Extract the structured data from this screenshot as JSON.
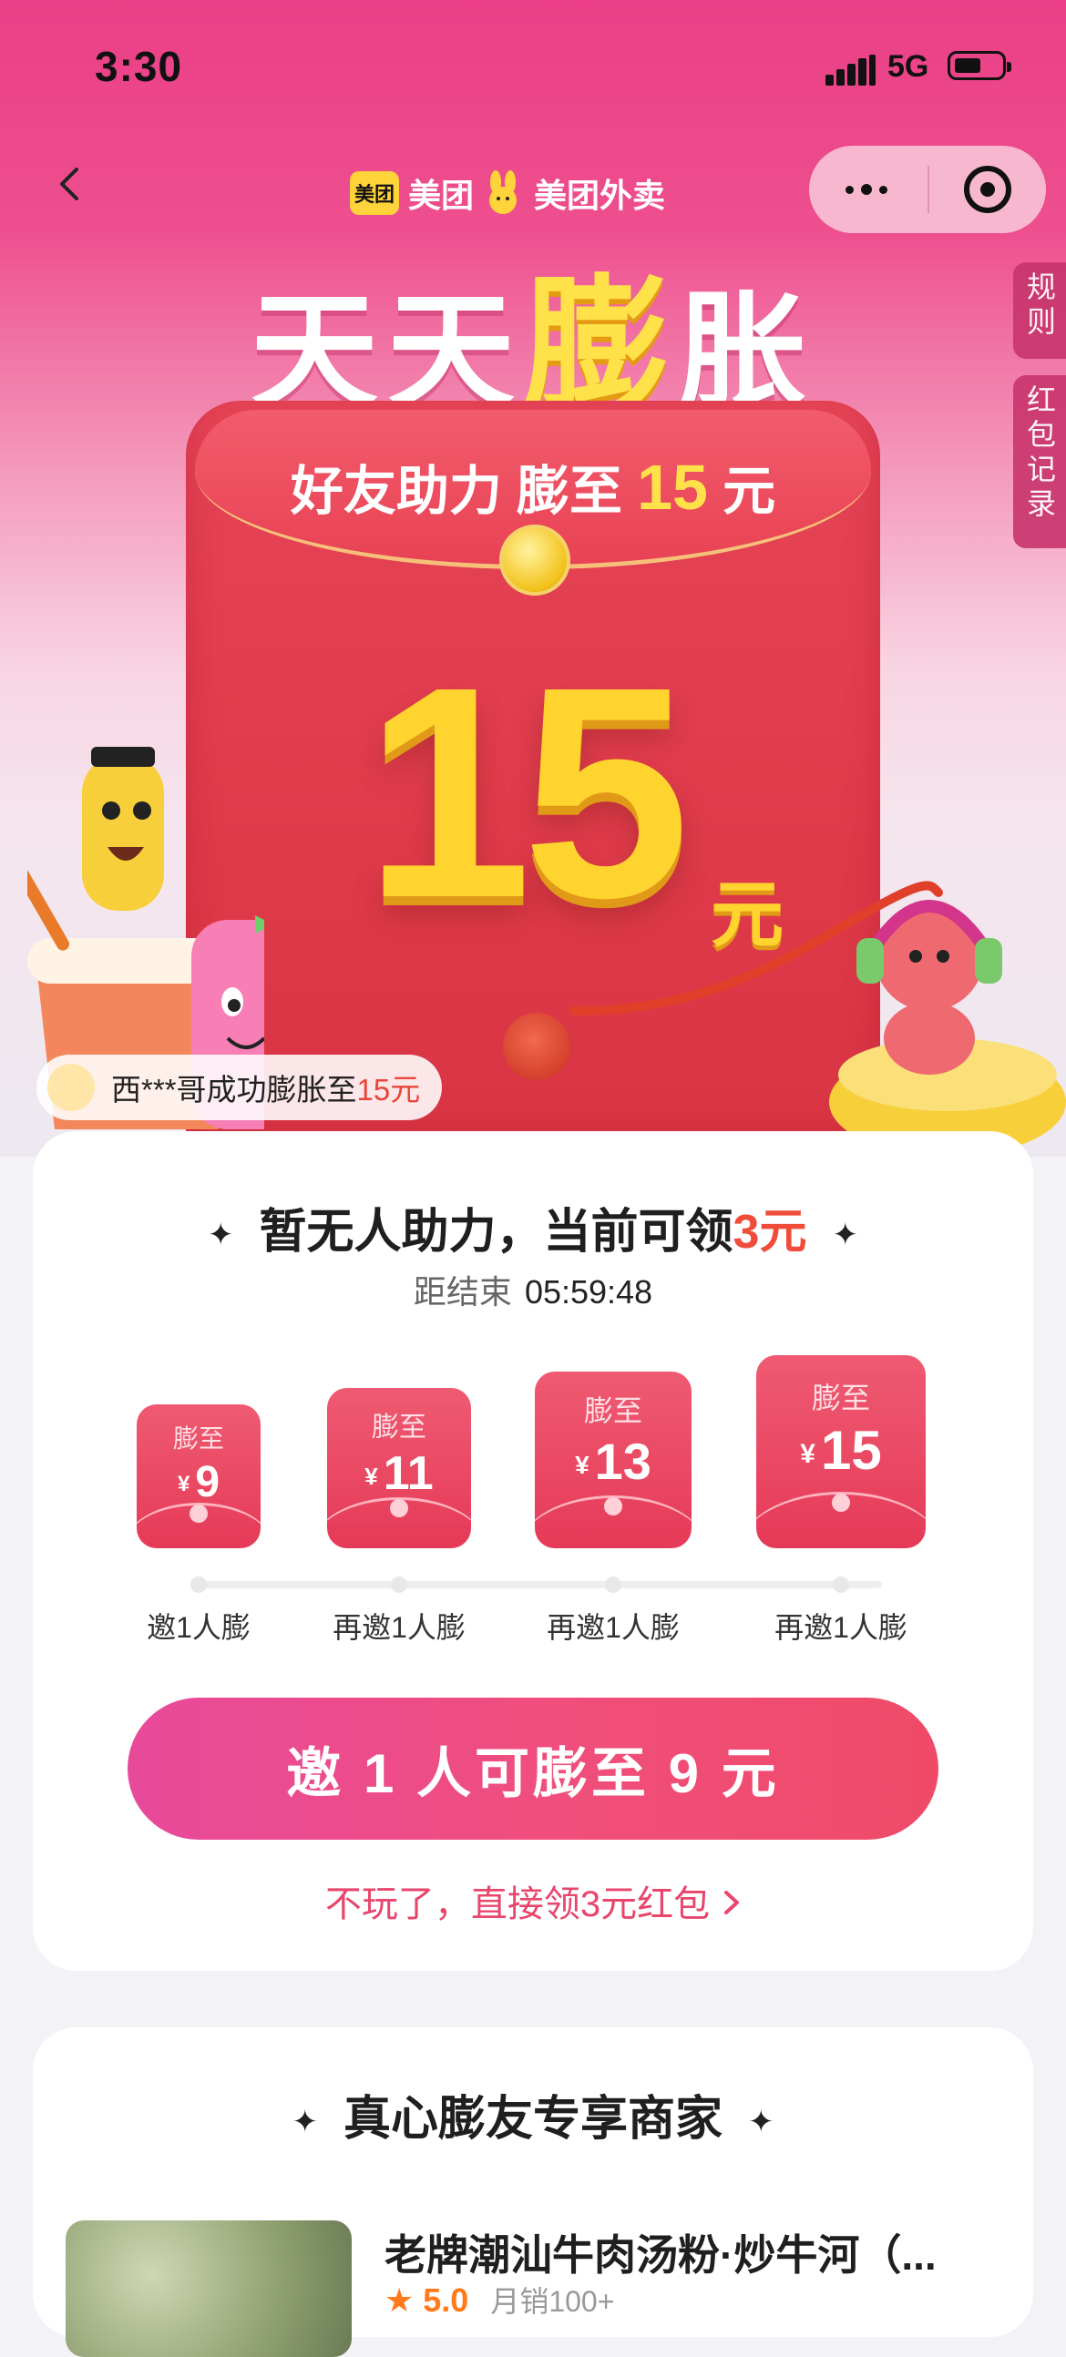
{
  "status_bar": {
    "time": "3:30",
    "network": "5G"
  },
  "header": {
    "brand_meituan": "美团",
    "brand_waimai": "美团外卖",
    "logo_text": "美团"
  },
  "hero": {
    "title_pre": "天天",
    "title_highlight": "膨",
    "title_post": "胀",
    "envelope_text": "好友助力 膨至",
    "envelope_amount": "15",
    "envelope_unit": "元",
    "big_amount": "15",
    "big_unit": "元",
    "ticker_text": "西***哥成功膨胀至",
    "ticker_amount": "15元"
  },
  "side_tabs": {
    "rules": "规则",
    "records": "红包记录"
  },
  "assist_card": {
    "title_prefix": "暂无人助力，当前可领",
    "title_amount": "3元",
    "countdown_label": "距结束",
    "countdown_value": "05:59:48",
    "steps": [
      {
        "label": "膨至",
        "currency": "¥",
        "value": "9",
        "caption": "邀1人膨"
      },
      {
        "label": "膨至",
        "currency": "¥",
        "value": "11",
        "caption": "再邀1人膨"
      },
      {
        "label": "膨至",
        "currency": "¥",
        "value": "13",
        "caption": "再邀1人膨"
      },
      {
        "label": "膨至",
        "currency": "¥",
        "value": "15",
        "caption": "再邀1人膨"
      }
    ],
    "cta_label": "邀 1 人可膨至 9 元",
    "skip_label": "不玩了，直接领3元红包"
  },
  "merchants": {
    "title": "真心膨友专享商家",
    "first_shop": {
      "name": "老牌潮汕牛肉汤粉·炒牛河（...",
      "rating": "5.0",
      "sales": "月销100+"
    }
  },
  "colors": {
    "brand_pink": "#ea3f86",
    "envelope_red": "#e64457",
    "gold": "#ffd42e",
    "accent_red": "#ef4c3a",
    "cta_gradient_start": "#e84a9b",
    "cta_gradient_end": "#ef4b68"
  }
}
